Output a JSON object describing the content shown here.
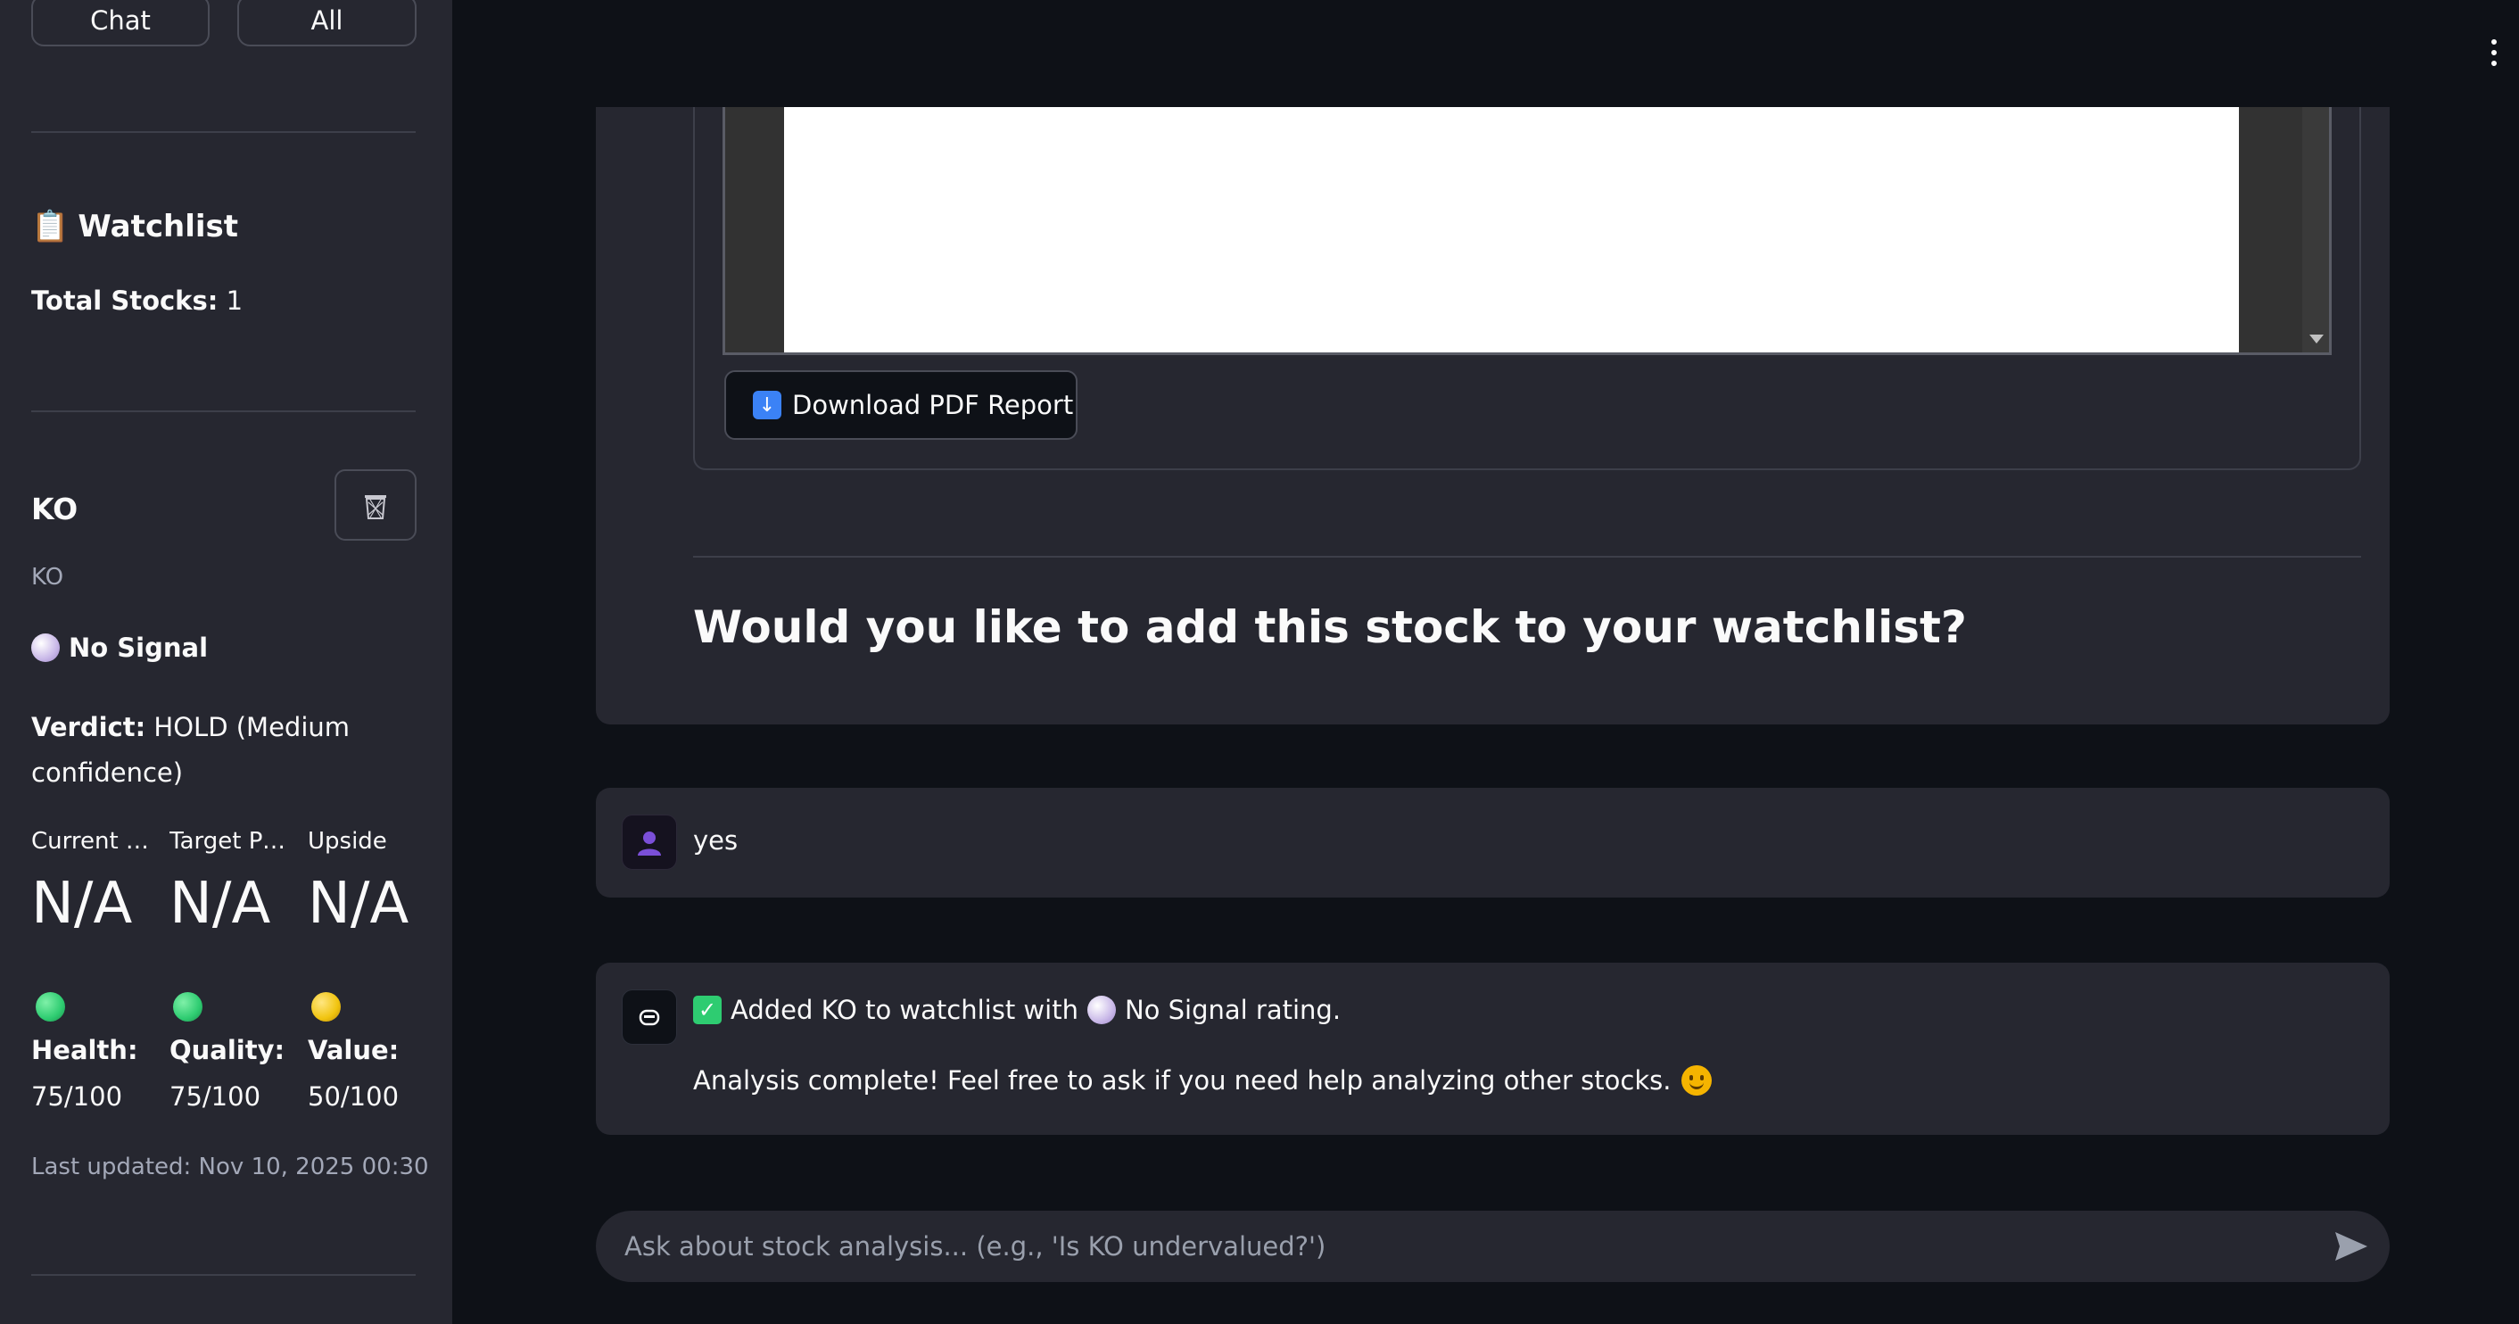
{
  "sidebar": {
    "chat_button": "Chat",
    "all_button": "All",
    "watchlist_icon": "📋",
    "watchlist_title": "Watchlist",
    "total_label": "Total Stocks:",
    "total_value": "1",
    "stock": {
      "ticker": "KO",
      "name": "KO",
      "signal_dot": "⚪",
      "signal": "No Signal",
      "verdict_label": "Verdict:",
      "verdict_line1": "HOLD (Medium",
      "verdict_line2": "confidence)",
      "metrics": [
        {
          "label": "Current Price",
          "value": "N/A"
        },
        {
          "label": "Target Price",
          "value": "N/A"
        },
        {
          "label": "Upside",
          "value": "N/A"
        }
      ],
      "scores": [
        {
          "label": "Health:",
          "value": "75/100",
          "color": "#2ecc71"
        },
        {
          "label": "Quality:",
          "value": "75/100",
          "color": "#2ecc71"
        },
        {
          "label": "Value:",
          "value": "50/100",
          "color": "#f1c40f"
        }
      ],
      "last_updated": "Last updated: Nov 10, 2025 00:30"
    }
  },
  "main": {
    "download_icon": "⬇️",
    "download_label": "Download PDF Report",
    "watchlist_question": "Would you like to add this stock to your watchlist?",
    "messages": [
      {
        "role": "user",
        "text": "yes"
      },
      {
        "role": "assistant",
        "check_icon": "✅",
        "line1_pre": "Added KO to watchlist with",
        "line1_post": "No Signal rating.",
        "line2": "Analysis complete! Feel free to ask if you need help analyzing other stocks.",
        "emoji": "😊"
      }
    ],
    "input_placeholder": "Ask about stock analysis... (e.g., 'Is KO undervalued?')"
  },
  "colors": {
    "sidebar_bg": "#262730",
    "main_bg": "#0e1117",
    "card_bg": "#262730",
    "user_avatar": "#6c3bd6",
    "check_green": "#2ecc71"
  }
}
